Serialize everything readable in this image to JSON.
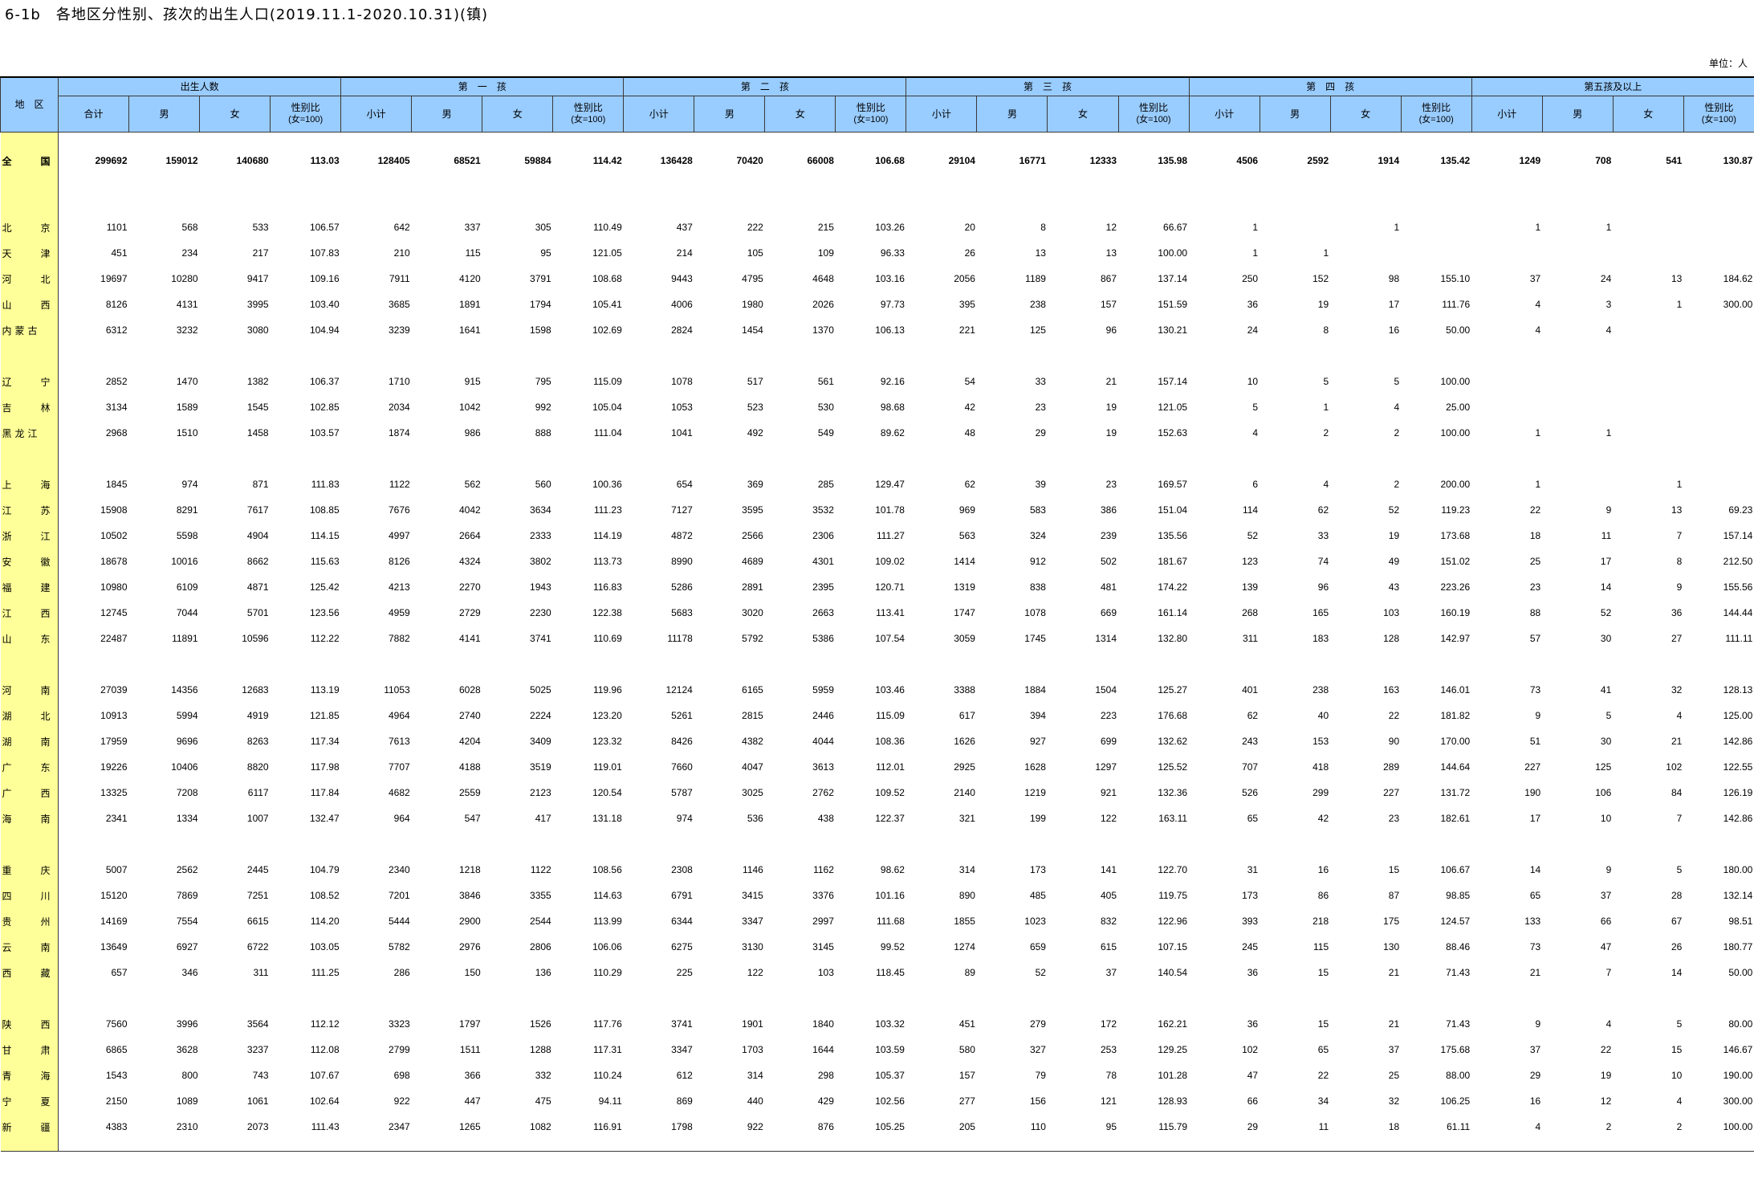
{
  "title": "6-1b　各地区分性别、孩次的出生人口(2019.11.1-2020.10.31)(镇)",
  "unit": "单位：人",
  "header": {
    "region": "地　区",
    "groups": [
      "出生人数",
      "第　一　孩",
      "第　二　孩",
      "第　三　孩",
      "第　四　孩",
      "第五孩及以上"
    ],
    "sub_total_first": "合计",
    "sub_total": "小计",
    "male": "男",
    "female": "女",
    "ratio_line1": "性别比",
    "ratio_line2": "(女=100)"
  },
  "rows": [
    {
      "region": "全　国",
      "v": [
        "299692",
        "159012",
        "140680",
        "113.03",
        "128405",
        "68521",
        "59884",
        "114.42",
        "136428",
        "70420",
        "66008",
        "106.68",
        "29104",
        "16771",
        "12333",
        "135.98",
        "4506",
        "2592",
        "1914",
        "135.42",
        "1249",
        "708",
        "541",
        "130.87"
      ]
    },
    {
      "region": "北　京",
      "v": [
        "1101",
        "568",
        "533",
        "106.57",
        "642",
        "337",
        "305",
        "110.49",
        "437",
        "222",
        "215",
        "103.26",
        "20",
        "8",
        "12",
        "66.67",
        "1",
        "",
        "1",
        "",
        "1",
        "1",
        "",
        ""
      ]
    },
    {
      "region": "天　津",
      "v": [
        "451",
        "234",
        "217",
        "107.83",
        "210",
        "115",
        "95",
        "121.05",
        "214",
        "105",
        "109",
        "96.33",
        "26",
        "13",
        "13",
        "100.00",
        "1",
        "1",
        "",
        "",
        "",
        "",
        "",
        ""
      ]
    },
    {
      "region": "河　北",
      "v": [
        "19697",
        "10280",
        "9417",
        "109.16",
        "7911",
        "4120",
        "3791",
        "108.68",
        "9443",
        "4795",
        "4648",
        "103.16",
        "2056",
        "1189",
        "867",
        "137.14",
        "250",
        "152",
        "98",
        "155.10",
        "37",
        "24",
        "13",
        "184.62"
      ]
    },
    {
      "region": "山　西",
      "v": [
        "8126",
        "4131",
        "3995",
        "103.40",
        "3685",
        "1891",
        "1794",
        "105.41",
        "4006",
        "1980",
        "2026",
        "97.73",
        "395",
        "238",
        "157",
        "151.59",
        "36",
        "19",
        "17",
        "111.76",
        "4",
        "3",
        "1",
        "300.00"
      ]
    },
    {
      "region": "内蒙古",
      "v": [
        "6312",
        "3232",
        "3080",
        "104.94",
        "3239",
        "1641",
        "1598",
        "102.69",
        "2824",
        "1454",
        "1370",
        "106.13",
        "221",
        "125",
        "96",
        "130.21",
        "24",
        "8",
        "16",
        "50.00",
        "4",
        "4",
        "",
        ""
      ]
    },
    {
      "region": "辽　宁",
      "v": [
        "2852",
        "1470",
        "1382",
        "106.37",
        "1710",
        "915",
        "795",
        "115.09",
        "1078",
        "517",
        "561",
        "92.16",
        "54",
        "33",
        "21",
        "157.14",
        "10",
        "5",
        "5",
        "100.00",
        "",
        "",
        "",
        ""
      ]
    },
    {
      "region": "吉　林",
      "v": [
        "3134",
        "1589",
        "1545",
        "102.85",
        "2034",
        "1042",
        "992",
        "105.04",
        "1053",
        "523",
        "530",
        "98.68",
        "42",
        "23",
        "19",
        "121.05",
        "5",
        "1",
        "4",
        "25.00",
        "",
        "",
        "",
        ""
      ]
    },
    {
      "region": "黑龙江",
      "v": [
        "2968",
        "1510",
        "1458",
        "103.57",
        "1874",
        "986",
        "888",
        "111.04",
        "1041",
        "492",
        "549",
        "89.62",
        "48",
        "29",
        "19",
        "152.63",
        "4",
        "2",
        "2",
        "100.00",
        "1",
        "1",
        "",
        ""
      ]
    },
    {
      "region": "上　海",
      "v": [
        "1845",
        "974",
        "871",
        "111.83",
        "1122",
        "562",
        "560",
        "100.36",
        "654",
        "369",
        "285",
        "129.47",
        "62",
        "39",
        "23",
        "169.57",
        "6",
        "4",
        "2",
        "200.00",
        "1",
        "",
        "1",
        ""
      ]
    },
    {
      "region": "江　苏",
      "v": [
        "15908",
        "8291",
        "7617",
        "108.85",
        "7676",
        "4042",
        "3634",
        "111.23",
        "7127",
        "3595",
        "3532",
        "101.78",
        "969",
        "583",
        "386",
        "151.04",
        "114",
        "62",
        "52",
        "119.23",
        "22",
        "9",
        "13",
        "69.23"
      ]
    },
    {
      "region": "浙　江",
      "v": [
        "10502",
        "5598",
        "4904",
        "114.15",
        "4997",
        "2664",
        "2333",
        "114.19",
        "4872",
        "2566",
        "2306",
        "111.27",
        "563",
        "324",
        "239",
        "135.56",
        "52",
        "33",
        "19",
        "173.68",
        "18",
        "11",
        "7",
        "157.14"
      ]
    },
    {
      "region": "安　徽",
      "v": [
        "18678",
        "10016",
        "8662",
        "115.63",
        "8126",
        "4324",
        "3802",
        "113.73",
        "8990",
        "4689",
        "4301",
        "109.02",
        "1414",
        "912",
        "502",
        "181.67",
        "123",
        "74",
        "49",
        "151.02",
        "25",
        "17",
        "8",
        "212.50"
      ]
    },
    {
      "region": "福　建",
      "v": [
        "10980",
        "6109",
        "4871",
        "125.42",
        "4213",
        "2270",
        "1943",
        "116.83",
        "5286",
        "2891",
        "2395",
        "120.71",
        "1319",
        "838",
        "481",
        "174.22",
        "139",
        "96",
        "43",
        "223.26",
        "23",
        "14",
        "9",
        "155.56"
      ]
    },
    {
      "region": "江　西",
      "v": [
        "12745",
        "7044",
        "5701",
        "123.56",
        "4959",
        "2729",
        "2230",
        "122.38",
        "5683",
        "3020",
        "2663",
        "113.41",
        "1747",
        "1078",
        "669",
        "161.14",
        "268",
        "165",
        "103",
        "160.19",
        "88",
        "52",
        "36",
        "144.44"
      ]
    },
    {
      "region": "山　东",
      "v": [
        "22487",
        "11891",
        "10596",
        "112.22",
        "7882",
        "4141",
        "3741",
        "110.69",
        "11178",
        "5792",
        "5386",
        "107.54",
        "3059",
        "1745",
        "1314",
        "132.80",
        "311",
        "183",
        "128",
        "142.97",
        "57",
        "30",
        "27",
        "111.11"
      ]
    },
    {
      "region": "河　南",
      "v": [
        "27039",
        "14356",
        "12683",
        "113.19",
        "11053",
        "6028",
        "5025",
        "119.96",
        "12124",
        "6165",
        "5959",
        "103.46",
        "3388",
        "1884",
        "1504",
        "125.27",
        "401",
        "238",
        "163",
        "146.01",
        "73",
        "41",
        "32",
        "128.13"
      ]
    },
    {
      "region": "湖　北",
      "v": [
        "10913",
        "5994",
        "4919",
        "121.85",
        "4964",
        "2740",
        "2224",
        "123.20",
        "5261",
        "2815",
        "2446",
        "115.09",
        "617",
        "394",
        "223",
        "176.68",
        "62",
        "40",
        "22",
        "181.82",
        "9",
        "5",
        "4",
        "125.00"
      ]
    },
    {
      "region": "湖　南",
      "v": [
        "17959",
        "9696",
        "8263",
        "117.34",
        "7613",
        "4204",
        "3409",
        "123.32",
        "8426",
        "4382",
        "4044",
        "108.36",
        "1626",
        "927",
        "699",
        "132.62",
        "243",
        "153",
        "90",
        "170.00",
        "51",
        "30",
        "21",
        "142.86"
      ]
    },
    {
      "region": "广　东",
      "v": [
        "19226",
        "10406",
        "8820",
        "117.98",
        "7707",
        "4188",
        "3519",
        "119.01",
        "7660",
        "4047",
        "3613",
        "112.01",
        "2925",
        "1628",
        "1297",
        "125.52",
        "707",
        "418",
        "289",
        "144.64",
        "227",
        "125",
        "102",
        "122.55"
      ]
    },
    {
      "region": "广　西",
      "v": [
        "13325",
        "7208",
        "6117",
        "117.84",
        "4682",
        "2559",
        "2123",
        "120.54",
        "5787",
        "3025",
        "2762",
        "109.52",
        "2140",
        "1219",
        "921",
        "132.36",
        "526",
        "299",
        "227",
        "131.72",
        "190",
        "106",
        "84",
        "126.19"
      ]
    },
    {
      "region": "海　南",
      "v": [
        "2341",
        "1334",
        "1007",
        "132.47",
        "964",
        "547",
        "417",
        "131.18",
        "974",
        "536",
        "438",
        "122.37",
        "321",
        "199",
        "122",
        "163.11",
        "65",
        "42",
        "23",
        "182.61",
        "17",
        "10",
        "7",
        "142.86"
      ]
    },
    {
      "region": "重　庆",
      "v": [
        "5007",
        "2562",
        "2445",
        "104.79",
        "2340",
        "1218",
        "1122",
        "108.56",
        "2308",
        "1146",
        "1162",
        "98.62",
        "314",
        "173",
        "141",
        "122.70",
        "31",
        "16",
        "15",
        "106.67",
        "14",
        "9",
        "5",
        "180.00"
      ]
    },
    {
      "region": "四　川",
      "v": [
        "15120",
        "7869",
        "7251",
        "108.52",
        "7201",
        "3846",
        "3355",
        "114.63",
        "6791",
        "3415",
        "3376",
        "101.16",
        "890",
        "485",
        "405",
        "119.75",
        "173",
        "86",
        "87",
        "98.85",
        "65",
        "37",
        "28",
        "132.14"
      ]
    },
    {
      "region": "贵　州",
      "v": [
        "14169",
        "7554",
        "6615",
        "114.20",
        "5444",
        "2900",
        "2544",
        "113.99",
        "6344",
        "3347",
        "2997",
        "111.68",
        "1855",
        "1023",
        "832",
        "122.96",
        "393",
        "218",
        "175",
        "124.57",
        "133",
        "66",
        "67",
        "98.51"
      ]
    },
    {
      "region": "云　南",
      "v": [
        "13649",
        "6927",
        "6722",
        "103.05",
        "5782",
        "2976",
        "2806",
        "106.06",
        "6275",
        "3130",
        "3145",
        "99.52",
        "1274",
        "659",
        "615",
        "107.15",
        "245",
        "115",
        "130",
        "88.46",
        "73",
        "47",
        "26",
        "180.77"
      ]
    },
    {
      "region": "西　藏",
      "v": [
        "657",
        "346",
        "311",
        "111.25",
        "286",
        "150",
        "136",
        "110.29",
        "225",
        "122",
        "103",
        "118.45",
        "89",
        "52",
        "37",
        "140.54",
        "36",
        "15",
        "21",
        "71.43",
        "21",
        "7",
        "14",
        "50.00"
      ]
    },
    {
      "region": "陕　西",
      "v": [
        "7560",
        "3996",
        "3564",
        "112.12",
        "3323",
        "1797",
        "1526",
        "117.76",
        "3741",
        "1901",
        "1840",
        "103.32",
        "451",
        "279",
        "172",
        "162.21",
        "36",
        "15",
        "21",
        "71.43",
        "9",
        "4",
        "5",
        "80.00"
      ]
    },
    {
      "region": "甘　肃",
      "v": [
        "6865",
        "3628",
        "3237",
        "112.08",
        "2799",
        "1511",
        "1288",
        "117.31",
        "3347",
        "1703",
        "1644",
        "103.59",
        "580",
        "327",
        "253",
        "129.25",
        "102",
        "65",
        "37",
        "175.68",
        "37",
        "22",
        "15",
        "146.67"
      ]
    },
    {
      "region": "青　海",
      "v": [
        "1543",
        "800",
        "743",
        "107.67",
        "698",
        "366",
        "332",
        "110.24",
        "612",
        "314",
        "298",
        "105.37",
        "157",
        "79",
        "78",
        "101.28",
        "47",
        "22",
        "25",
        "88.00",
        "29",
        "19",
        "10",
        "190.00"
      ]
    },
    {
      "region": "宁　夏",
      "v": [
        "2150",
        "1089",
        "1061",
        "102.64",
        "922",
        "447",
        "475",
        "94.11",
        "869",
        "440",
        "429",
        "102.56",
        "277",
        "156",
        "121",
        "128.93",
        "66",
        "34",
        "32",
        "106.25",
        "16",
        "12",
        "4",
        "300.00"
      ]
    },
    {
      "region": "新　疆",
      "v": [
        "4383",
        "2310",
        "2073",
        "111.43",
        "2347",
        "1265",
        "1082",
        "116.91",
        "1798",
        "922",
        "876",
        "105.25",
        "205",
        "110",
        "95",
        "115.79",
        "29",
        "11",
        "18",
        "61.11",
        "4",
        "2",
        "2",
        "100.00"
      ]
    }
  ]
}
